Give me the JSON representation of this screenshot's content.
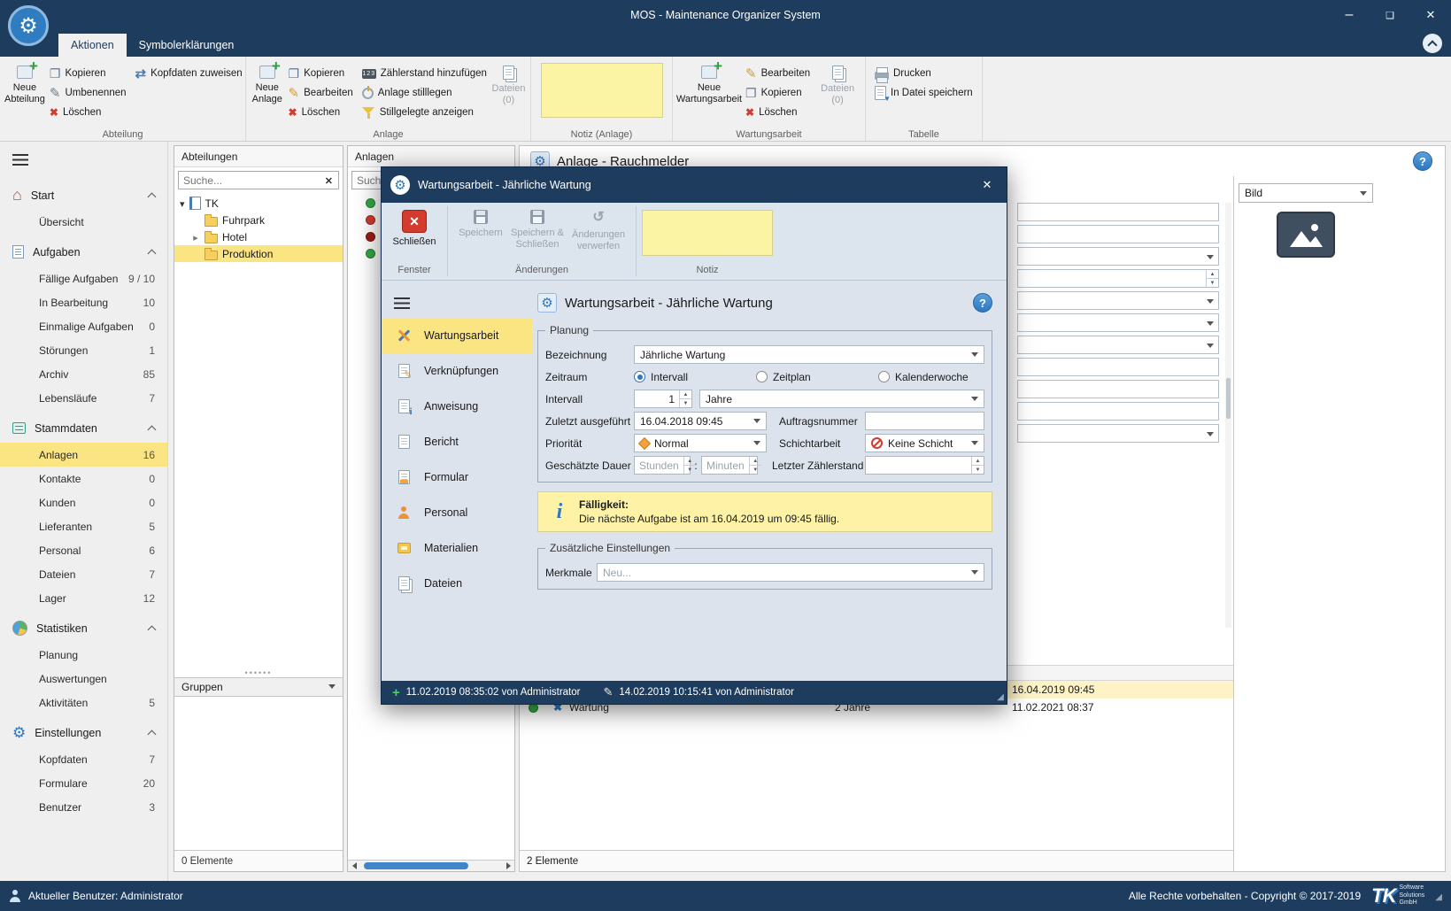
{
  "colors": {
    "titlebar_navy": "#1d3c5e",
    "accent_blue": "#2e77c0",
    "selection_yellow": "#fbe482",
    "note_yellow": "#faf4a4",
    "delete_red": "#d23b2e",
    "status_green": "#35a845",
    "status_red": "#d23b2e",
    "status_darkred": "#9c1f16"
  },
  "window": {
    "title": "MOS - Maintenance Organizer System"
  },
  "tabs": {
    "aktionen": "Aktionen",
    "symbolerklaerungen": "Symbolerklärungen"
  },
  "ribbon": {
    "groups": [
      {
        "label": "Abteilung",
        "buttons": {
          "neu": "Neue Abteilung",
          "kopieren": "Kopieren",
          "umbenennen": "Umbenennen",
          "loeschen": "Löschen",
          "kopfdaten": "Kopfdaten zuweisen"
        }
      },
      {
        "label": "Anlage",
        "buttons": {
          "neu": "Neue Anlage",
          "kopieren": "Kopieren",
          "bearbeiten": "Bearbeiten",
          "loeschen": "Löschen",
          "zaehlerstand": "Zählerstand hinzufügen",
          "stilllegen": "Anlage stilllegen",
          "stillgelegte": "Stillgelegte anzeigen",
          "dateien": "Dateien (0)"
        }
      },
      {
        "label": "Notiz (Anl­age)"
      },
      {
        "label": "Wartungsarbeit",
        "buttons": {
          "neu": "Neue Wartungsarbeit",
          "bearbeiten": "Bearbeiten",
          "kopieren": "Kopieren",
          "loeschen": "Löschen",
          "dateien": "Dateien (0)"
        }
      },
      {
        "label": "Tabelle",
        "buttons": {
          "drucken": "Drucken",
          "speichern": "In Datei speichern"
        }
      }
    ]
  },
  "sidebar": {
    "sections": [
      {
        "label": "Start",
        "items": [
          {
            "label": "Übersicht",
            "count": ""
          }
        ]
      },
      {
        "label": "Aufgaben",
        "items": [
          {
            "label": "Fällige Aufgaben",
            "count": "9 / 10"
          },
          {
            "label": "In Bearbeitung",
            "count": "10"
          },
          {
            "label": "Einmalige Aufgaben",
            "count": "0"
          },
          {
            "label": "Störungen",
            "count": "1"
          },
          {
            "label": "Archiv",
            "count": "85"
          },
          {
            "label": "Lebensläufe",
            "count": "7"
          }
        ]
      },
      {
        "label": "Stammdaten",
        "items": [
          {
            "label": "Anlagen",
            "count": "16"
          },
          {
            "label": "Kontakte",
            "count": "0"
          },
          {
            "label": "Kunden",
            "count": "0"
          },
          {
            "label": "Lieferanten",
            "count": "5"
          },
          {
            "label": "Personal",
            "count": "6"
          },
          {
            "label": "Dateien",
            "count": "7"
          },
          {
            "label": "Lager",
            "count": "12"
          }
        ]
      },
      {
        "label": "Statistiken",
        "items": [
          {
            "label": "Planung",
            "count": ""
          },
          {
            "label": "Auswertungen",
            "count": ""
          },
          {
            "label": "Aktivitäten",
            "count": "5"
          }
        ]
      },
      {
        "label": "Einstellungen",
        "items": [
          {
            "label": "Kopfdaten",
            "count": "7"
          },
          {
            "label": "Formulare",
            "count": "20"
          },
          {
            "label": "Benutzer",
            "count": "3"
          }
        ]
      }
    ]
  },
  "abteilungen": {
    "title": "Abteilungen",
    "search_placeholder": "Suche...",
    "tree_root": "TK",
    "tree_children": [
      "Fuhrpark",
      "Hotel",
      "Produktion"
    ],
    "selected_child": "Produktion",
    "gruppen_label": "Gruppen",
    "status": "0 Elemente"
  },
  "anlagen": {
    "title": "Anlagen",
    "search_placeholder": "Suche...",
    "items": [
      {
        "status": "green"
      },
      {
        "status": "red"
      },
      {
        "status": "darkred"
      },
      {
        "status": "green"
      }
    ]
  },
  "main": {
    "title": "Anlage - Rauchmelder",
    "bild_label": "Bild",
    "table_rows": [
      {
        "name": "",
        "intervall": "",
        "naechste": "16.04.2019 09:45"
      },
      {
        "name": "Wartung",
        "intervall": "2 Jahre",
        "naechste": "11.02.2021 08:37"
      }
    ],
    "status": "2 Elemente"
  },
  "dialog": {
    "title": "Wartungsarbeit - Jährliche Wartung",
    "toolbar": {
      "schliessen": "Schließen",
      "speichern": "Speichern",
      "speichern_schliessen": "Speichern & Schließen",
      "verwerfen": "Änderungen verwerfen",
      "grp_fenster": "Fenster",
      "grp_aenderungen": "Änderungen",
      "grp_notiz": "Notiz"
    },
    "nav": [
      {
        "label": "Wartungsarbeit"
      },
      {
        "label": "Verknüpfungen"
      },
      {
        "label": "Anweisung"
      },
      {
        "label": "Bericht"
      },
      {
        "label": "Formular"
      },
      {
        "label": "Personal"
      },
      {
        "label": "Materialien"
      },
      {
        "label": "Dateien"
      }
    ],
    "heading": "Wartungsarbeit - Jährliche Wartung",
    "planung": {
      "group_label": "Planung",
      "bezeichnung_label": "Bezeichnung",
      "bezeichnung_value": "Jährliche Wartung",
      "zeitraum_label": "Zeitraum",
      "radio_intervall": "Intervall",
      "radio_zeitplan": "Zeitplan",
      "radio_kalenderwoche": "Kalenderwoche",
      "intervall_label": "Intervall",
      "intervall_value": "1",
      "intervall_einheit": "Jahre",
      "zuletzt_label": "Zuletzt ausgeführt",
      "zuletzt_value": "16.04.2018 09:45",
      "auftragsnummer_label": "Auftragsnummer",
      "prioritaet_label": "Priorität",
      "prioritaet_value": "Normal",
      "schicht_label": "Schichtarbeit",
      "schicht_value": "Keine Schicht",
      "dauer_label": "Geschätzte Dauer",
      "stunden_placeholder": "Stunden",
      "dauer_sep": ":",
      "minuten_placeholder": "Minuten",
      "zaehler_label": "Letzter Zählerstand"
    },
    "faelligkeit": {
      "title": "Fälligkeit:",
      "text": "Die nächste Aufgabe ist am 16.04.2019 um 09:45 fällig."
    },
    "zusatz": {
      "group_label": "Zusätzliche Einstellungen",
      "merkmale_label": "Merkmale",
      "merkmale_placeholder": "Neu..."
    },
    "footer": {
      "created": "11.02.2019 08:35:02 von Administrator",
      "modified": "14.02.2019 10:15:41 von Administrator"
    }
  },
  "statusbar": {
    "user": "Aktueller Benutzer: Administrator",
    "copyright": "Alle Rechte vorbehalten - Copyright © 2017-2019",
    "logo_tk": "TK",
    "logo_sub1": "Software",
    "logo_sub2": "Solutions",
    "logo_sub3": "GmbH"
  }
}
